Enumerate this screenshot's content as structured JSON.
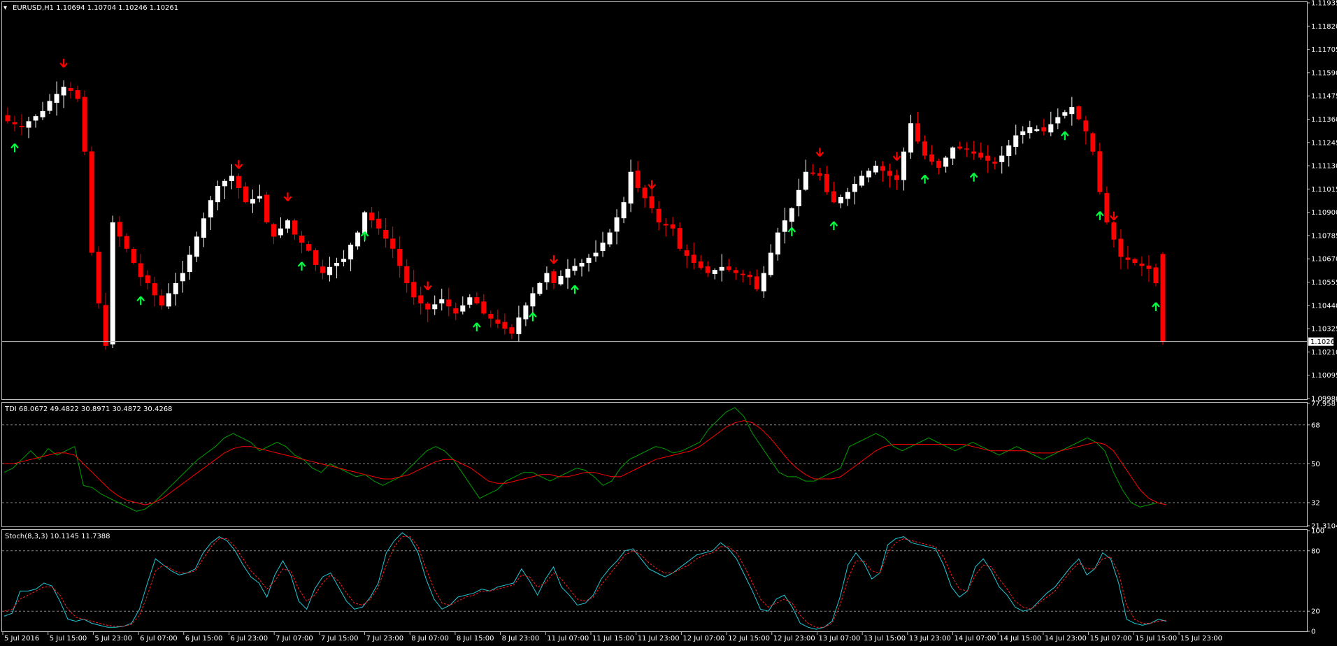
{
  "window": {
    "title_caret": "▾",
    "main_info": "EURUSD,H1  1.10694 1.10704 1.10246 1.10261",
    "tdi_info": "TDI 68.0672 49.4822 30.8971 30.4872 30.4268",
    "stoch_info": "Stoch(8,3,3) 10.1145 11.7388"
  },
  "colors": {
    "background": "#000000",
    "frame": "#c0c0c0",
    "bull_candle": "#ffffff",
    "bear_candle": "#ff0000",
    "up_arrow": "#00ff40",
    "down_arrow": "#ff0000",
    "tdi_green": "#00a000",
    "tdi_red": "#ff0000",
    "stoch_main": "#20c8d8",
    "stoch_signal": "#ff2020"
  },
  "chart_data": [
    {
      "type": "candlestick",
      "symbol": "EURUSD",
      "timeframe": "H1",
      "ohlc_last": [
        1.10694,
        1.10704,
        1.10246,
        1.10261
      ],
      "ylim": [
        1.0998,
        1.11935
      ],
      "yticks": [
        "1.11935",
        "1.11820",
        "1.11705",
        "1.11590",
        "1.11475",
        "1.11360",
        "1.11245",
        "1.11130",
        "1.11015",
        "1.10900",
        "1.10785",
        "1.10670",
        "1.10555",
        "1.10440",
        "1.10325",
        "1.10210",
        "1.10095",
        "1.09980"
      ],
      "current_price_label": "1.10261",
      "current_price": 1.10261,
      "xticks": [
        "5 Jul 2016",
        "5 Jul 15:00",
        "5 Jul 23:00",
        "6 Jul 07:00",
        "6 Jul 15:00",
        "6 Jul 23:00",
        "7 Jul 07:00",
        "7 Jul 15:00",
        "7 Jul 23:00",
        "8 Jul 07:00",
        "8 Jul 15:00",
        "8 Jul 23:00",
        "11 Jul 07:00",
        "11 Jul 15:00",
        "11 Jul 23:00",
        "12 Jul 07:00",
        "12 Jul 15:00",
        "12 Jul 23:00",
        "13 Jul 07:00",
        "13 Jul 15:00",
        "13 Jul 23:00",
        "14 Jul 07:00",
        "14 Jul 15:00",
        "14 Jul 23:00",
        "15 Jul 07:00",
        "15 Jul 15:00",
        "15 Jul 23:00"
      ],
      "close_path": [
        [
          0,
          1.1135
        ],
        [
          2,
          1.1132
        ],
        [
          3,
          1.1135
        ],
        [
          5,
          1.114
        ],
        [
          6,
          1.1145
        ],
        [
          8,
          1.1152
        ],
        [
          9,
          1.115
        ],
        [
          10,
          1.1146
        ],
        [
          11,
          1.112
        ],
        [
          12,
          1.107
        ],
        [
          13,
          1.1045
        ],
        [
          14,
          1.1024
        ],
        [
          15,
          1.1085
        ],
        [
          16,
          1.1078
        ],
        [
          17,
          1.1072
        ],
        [
          18,
          1.1065
        ],
        [
          19,
          1.1058
        ],
        [
          20,
          1.1055
        ],
        [
          21,
          1.1049
        ],
        [
          22,
          1.1044
        ],
        [
          23,
          1.105
        ],
        [
          25,
          1.106
        ],
        [
          27,
          1.1078
        ],
        [
          28,
          1.1087
        ],
        [
          29,
          1.1096
        ],
        [
          30,
          1.1103
        ],
        [
          32,
          1.1108
        ],
        [
          33,
          1.1102
        ],
        [
          34,
          1.1095
        ],
        [
          36,
          1.1098
        ],
        [
          37,
          1.1085
        ],
        [
          38,
          1.1078
        ],
        [
          40,
          1.1086
        ],
        [
          41,
          1.1079
        ],
        [
          43,
          1.1071
        ],
        [
          44,
          1.1064
        ],
        [
          45,
          1.106
        ],
        [
          46,
          1.1063
        ],
        [
          47,
          1.1065
        ],
        [
          48,
          1.1067
        ],
        [
          49,
          1.1074
        ],
        [
          50,
          1.108
        ],
        [
          51,
          1.109
        ],
        [
          53,
          1.1082
        ],
        [
          55,
          1.1072
        ],
        [
          57,
          1.1055
        ],
        [
          58,
          1.1048
        ],
        [
          60,
          1.1042
        ],
        [
          62,
          1.1047
        ],
        [
          64,
          1.104
        ],
        [
          66,
          1.1048
        ],
        [
          67,
          1.1045
        ],
        [
          68,
          1.104
        ],
        [
          70,
          1.1035
        ],
        [
          72,
          1.103
        ],
        [
          73,
          1.1038
        ],
        [
          75,
          1.105
        ],
        [
          77,
          1.106
        ],
        [
          78,
          1.1055
        ],
        [
          80,
          1.1062
        ],
        [
          82,
          1.1065
        ],
        [
          84,
          1.107
        ],
        [
          86,
          1.108
        ],
        [
          88,
          1.1095
        ],
        [
          89,
          1.111
        ],
        [
          90,
          1.1102
        ],
        [
          92,
          1.1092
        ],
        [
          93,
          1.1085
        ],
        [
          95,
          1.1082
        ],
        [
          96,
          1.1072
        ],
        [
          98,
          1.1065
        ],
        [
          100,
          1.106
        ],
        [
          102,
          1.1063
        ],
        [
          104,
          1.106
        ],
        [
          106,
          1.1058
        ],
        [
          107,
          1.1052
        ],
        [
          108,
          1.106
        ],
        [
          110,
          1.108
        ],
        [
          112,
          1.1092
        ],
        [
          114,
          1.111
        ],
        [
          116,
          1.1108
        ],
        [
          117,
          1.11
        ],
        [
          118,
          1.1095
        ],
        [
          120,
          1.11
        ],
        [
          122,
          1.1108
        ],
        [
          124,
          1.1113
        ],
        [
          126,
          1.1108
        ],
        [
          127,
          1.1106
        ],
        [
          128,
          1.112
        ],
        [
          129,
          1.1134
        ],
        [
          130,
          1.1125
        ],
        [
          131,
          1.1118
        ],
        [
          133,
          1.1112
        ],
        [
          135,
          1.1122
        ],
        [
          137,
          1.1121
        ],
        [
          139,
          1.1117
        ],
        [
          141,
          1.1114
        ],
        [
          142,
          1.1118
        ],
        [
          144,
          1.1128
        ],
        [
          146,
          1.1132
        ],
        [
          148,
          1.113
        ],
        [
          150,
          1.1137
        ],
        [
          152,
          1.1142
        ],
        [
          154,
          1.113
        ],
        [
          155,
          1.112
        ],
        [
          156,
          1.11
        ],
        [
          157,
          1.1085
        ],
        [
          159,
          1.1068
        ],
        [
          161,
          1.1065
        ],
        [
          163,
          1.1062
        ],
        [
          164,
          1.1055
        ],
        [
          165,
          1.1026
        ]
      ],
      "up_arrows_at": [
        1,
        19,
        42,
        51,
        67,
        75,
        81,
        112,
        118,
        131,
        138,
        151,
        156,
        164
      ],
      "down_arrows_at": [
        8,
        33,
        40,
        60,
        78,
        92,
        116,
        127,
        158
      ]
    },
    {
      "type": "line",
      "title": "TDI",
      "ylim": [
        21.3104,
        77.9587
      ],
      "yticks": [
        "77.9587",
        "68",
        "50",
        "32",
        "21.3104"
      ],
      "series": [
        {
          "color": "green",
          "values": [
            46,
            48,
            52,
            56,
            52,
            57,
            54,
            56,
            58,
            40,
            39,
            36,
            34,
            32,
            30,
            28,
            29,
            32,
            36,
            40,
            44,
            48,
            52,
            55,
            58,
            62,
            64,
            62,
            60,
            56,
            58,
            60,
            58,
            54,
            52,
            48,
            46,
            50,
            48,
            46,
            44,
            45,
            42,
            40,
            42,
            44,
            48,
            52,
            56,
            58,
            56,
            52,
            46,
            40,
            34,
            36,
            38,
            42,
            44,
            46,
            46,
            44,
            42,
            44,
            46,
            48,
            47,
            44,
            40,
            42,
            48,
            52,
            54,
            56,
            58,
            57,
            55,
            56,
            58,
            60,
            66,
            70,
            74,
            76,
            72,
            64,
            58,
            52,
            46,
            44,
            44,
            42,
            42,
            44,
            46,
            48,
            58,
            60,
            62,
            64,
            62,
            58,
            56,
            58,
            60,
            62,
            60,
            58,
            56,
            58,
            60,
            58,
            56,
            54,
            56,
            58,
            56,
            54,
            52,
            54,
            56,
            58,
            60,
            62,
            60,
            56,
            46,
            38,
            32,
            30,
            31,
            32,
            31
          ]
        },
        {
          "color": "red",
          "values": [
            50,
            50,
            51,
            52,
            53,
            54,
            55,
            55,
            54,
            50,
            46,
            42,
            38,
            35,
            33,
            32,
            31,
            32,
            34,
            37,
            40,
            43,
            46,
            49,
            52,
            55,
            57,
            58,
            58,
            57,
            56,
            55,
            54,
            53,
            52,
            51,
            50,
            49,
            48,
            47,
            46,
            45,
            44,
            43,
            43,
            44,
            45,
            47,
            49,
            51,
            52,
            52,
            50,
            48,
            45,
            42,
            41,
            41,
            42,
            43,
            44,
            45,
            45,
            44,
            44,
            45,
            46,
            46,
            45,
            44,
            44,
            46,
            48,
            50,
            52,
            53,
            54,
            55,
            56,
            58,
            61,
            64,
            67,
            69,
            70,
            69,
            66,
            62,
            57,
            52,
            48,
            45,
            43,
            43,
            43,
            44,
            47,
            50,
            53,
            56,
            58,
            59,
            59,
            59,
            59,
            59,
            59,
            59,
            59,
            59,
            58,
            57,
            56,
            56,
            56,
            56,
            56,
            55,
            55,
            55,
            56,
            57,
            58,
            59,
            60,
            59,
            56,
            50,
            44,
            38,
            34,
            32,
            31
          ]
        }
      ]
    },
    {
      "type": "line",
      "title": "Stoch(8,3,3)",
      "ylim": [
        0,
        100
      ],
      "yticks": [
        "100",
        "80",
        "20",
        "0"
      ],
      "series": [
        {
          "color": "cyan",
          "values": [
            15,
            18,
            40,
            40,
            42,
            48,
            45,
            30,
            12,
            10,
            12,
            8,
            6,
            4,
            4,
            5,
            8,
            22,
            48,
            72,
            66,
            60,
            56,
            58,
            62,
            78,
            88,
            94,
            90,
            80,
            66,
            54,
            48,
            34,
            56,
            70,
            56,
            30,
            22,
            42,
            54,
            58,
            44,
            30,
            22,
            24,
            34,
            48,
            78,
            90,
            98,
            92,
            78,
            52,
            32,
            22,
            26,
            34,
            36,
            38,
            42,
            40,
            44,
            46,
            48,
            62,
            50,
            36,
            52,
            64,
            44,
            36,
            26,
            28,
            36,
            52,
            62,
            70,
            80,
            82,
            72,
            62,
            58,
            54,
            58,
            64,
            70,
            76,
            78,
            80,
            88,
            82,
            72,
            56,
            40,
            22,
            20,
            32,
            36,
            24,
            8,
            4,
            2,
            4,
            10,
            34,
            66,
            78,
            68,
            52,
            58,
            86,
            92,
            94,
            88,
            86,
            84,
            82,
            66,
            44,
            34,
            40,
            64,
            72,
            60,
            44,
            36,
            24,
            20,
            22,
            30,
            38,
            44,
            54,
            64,
            72,
            56,
            62,
            78,
            72,
            48,
            12,
            8,
            6,
            8,
            12,
            10
          ]
        },
        {
          "color": "red",
          "values": [
            20,
            22,
            32,
            36,
            40,
            44,
            44,
            36,
            22,
            14,
            12,
            10,
            8,
            6,
            5,
            5,
            7,
            16,
            36,
            60,
            66,
            62,
            58,
            58,
            60,
            72,
            84,
            92,
            92,
            84,
            72,
            60,
            52,
            42,
            50,
            62,
            60,
            42,
            30,
            36,
            48,
            56,
            50,
            38,
            28,
            26,
            32,
            44,
            66,
            84,
            94,
            94,
            84,
            62,
            42,
            28,
            26,
            30,
            34,
            36,
            40,
            40,
            42,
            44,
            46,
            56,
            54,
            44,
            48,
            58,
            52,
            42,
            32,
            30,
            34,
            46,
            56,
            66,
            76,
            80,
            76,
            68,
            62,
            58,
            58,
            62,
            66,
            72,
            76,
            78,
            84,
            84,
            78,
            64,
            48,
            32,
            24,
            28,
            32,
            28,
            16,
            8,
            4,
            4,
            8,
            26,
            52,
            70,
            70,
            60,
            58,
            78,
            88,
            92,
            90,
            88,
            86,
            84,
            74,
            56,
            42,
            40,
            56,
            66,
            64,
            52,
            42,
            30,
            24,
            22,
            28,
            34,
            40,
            50,
            60,
            68,
            62,
            62,
            72,
            74,
            58,
            26,
            12,
            8,
            8,
            10,
            11
          ]
        }
      ]
    }
  ]
}
